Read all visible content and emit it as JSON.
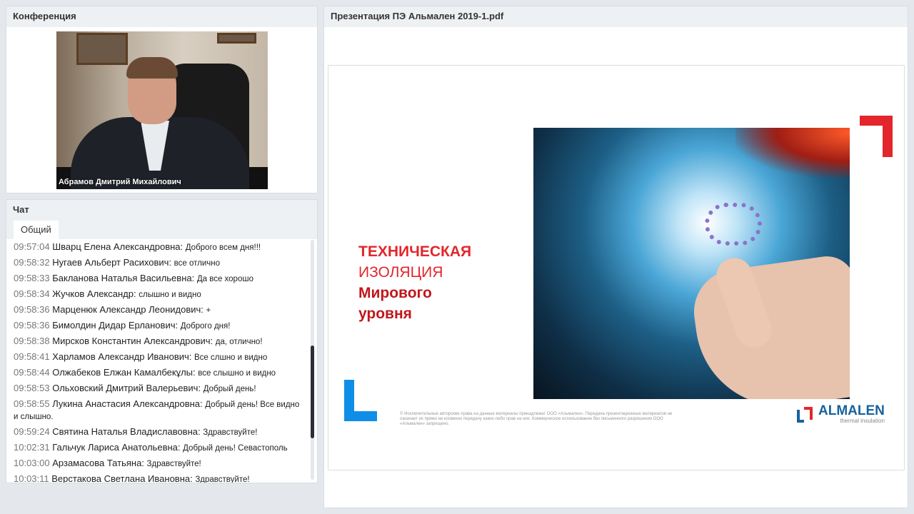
{
  "conference": {
    "title": "Конференция",
    "speaker_name": "Абрамов Дмитрий Михайлович"
  },
  "chat": {
    "title": "Чат",
    "tab": "Общий",
    "messages": [
      {
        "time": "09:57:04",
        "author": "Шварц Елена Александровна:",
        "text": "Доброго всем дня!!!"
      },
      {
        "time": "09:58:32",
        "author": "Нугаев Альберт Расихович:",
        "text": "все отлично"
      },
      {
        "time": "09:58:33",
        "author": "Бакланова Наталья Васильевна:",
        "text": "Да все хорошо"
      },
      {
        "time": "09:58:34",
        "author": "Жучков Александр:",
        "text": "слышно и видно"
      },
      {
        "time": "09:58:36",
        "author": "Марценюк Александр Леонидович:",
        "text": "+"
      },
      {
        "time": "09:58:36",
        "author": "Бимолдин Дидар Ерланович:",
        "text": "Доброго дня!"
      },
      {
        "time": "09:58:38",
        "author": "Мирсков Константин Александрович:",
        "text": "да, отлично!"
      },
      {
        "time": "09:58:41",
        "author": "Харламов Александр Иванович:",
        "text": "Все слшно и видно"
      },
      {
        "time": "09:58:44",
        "author": "Олжабеков Елжан Камалбекұлы:",
        "text": "все слышно и видно"
      },
      {
        "time": "09:58:53",
        "author": "Ольховский Дмитрий Валерьевич:",
        "text": "Добрый день!"
      },
      {
        "time": "09:58:55",
        "author": "Лукина Анастасия Александровна:",
        "text": "Добрый день! Все видно и слышно."
      },
      {
        "time": "09:59:24",
        "author": "Святина Наталья Владиславовна:",
        "text": "Здравствуйте!"
      },
      {
        "time": "10:02:31",
        "author": "Гальчук Лариса Анатольевна:",
        "text": "Добрый день! Севастополь"
      },
      {
        "time": "10:03:00",
        "author": "Арзамасова Татьяна:",
        "text": "Здравствуйте!"
      },
      {
        "time": "10:03:11",
        "author": "Верстакова Светлана Ивановна:",
        "text": "Здравствуйте!"
      }
    ],
    "scroll_position": 0.72
  },
  "presentation": {
    "title": "Презентация ПЭ Альмален 2019-1.pdf",
    "slide": {
      "heading_line1": "ТЕХНИЧЕСКАЯ",
      "heading_line2": "ИЗОЛЯЦИЯ",
      "heading_line3": "Мирового",
      "heading_line4": "уровня",
      "logo_name": "ALMALEN",
      "logo_tagline": "thermal insulation",
      "fine_print": "© Исключительные авторские права на данные материалы принадлежат ООО «Альмален». Передача презентационных материалов не означает их прямо ни косвенно передачу каких-либо прав на них. Коммерческое использование без письменного разрешения ООО «Альмален» запрещено."
    }
  },
  "colors": {
    "brand_red": "#e2262b",
    "brand_blue": "#0f8ee8",
    "logo_blue": "#17629e"
  }
}
